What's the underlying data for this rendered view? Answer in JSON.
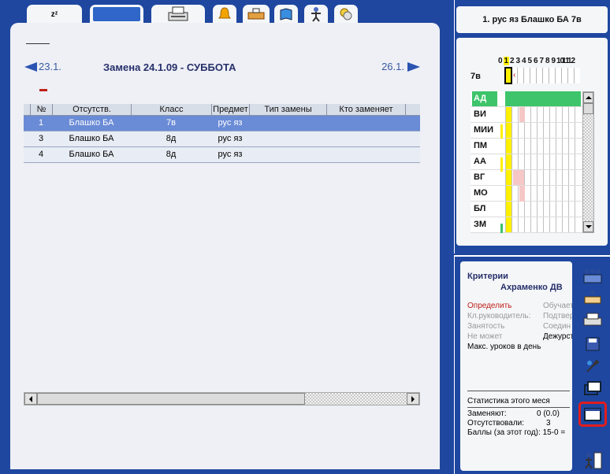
{
  "left": {
    "tabs": [
      {
        "name": "tab-sleep",
        "glyph": "z",
        "color": "#f4f6f8"
      },
      {
        "name": "tab-people",
        "glyph": "",
        "color": "#2f66c8"
      },
      {
        "name": "tab-print",
        "glyph": "",
        "color": "#f4f6f8"
      },
      {
        "name": "tab-bell",
        "glyph": "",
        "color": "#f4f6f8"
      },
      {
        "name": "tab-desk",
        "glyph": "",
        "color": "#f4f6f8"
      },
      {
        "name": "tab-book",
        "glyph": "",
        "color": "#f4f6f8"
      },
      {
        "name": "tab-person",
        "glyph": "",
        "color": "#f4f6f8"
      },
      {
        "name": "tab-coins",
        "glyph": "",
        "color": "#f4f6f8"
      }
    ],
    "nav": {
      "prev_label": "23.1.",
      "title": "Замена 24.1.09 - СУББОТА",
      "next_label": "26.1."
    },
    "table": {
      "headers": [
        "№",
        "Отсутств.",
        "Класс",
        "Предмет",
        "Тип замены",
        "Кто заменяет"
      ],
      "rows": [
        {
          "num": "1",
          "absent": "Блашко БА",
          "class": "7в",
          "subject": "рус яз",
          "type": "",
          "who": ""
        },
        {
          "num": "3",
          "absent": "Блашко БА",
          "class": "8д",
          "subject": "рус яз",
          "type": "",
          "who": ""
        },
        {
          "num": "4",
          "absent": "Блашко БА",
          "class": "8д",
          "subject": "рус яз",
          "type": "",
          "who": ""
        }
      ]
    }
  },
  "right_top": {
    "info": "1. рус яз Блашко БА 7в",
    "periods": [
      "0",
      "1",
      "2",
      "3",
      "4",
      "5",
      "6",
      "7",
      "8",
      "9",
      "10",
      "11",
      "12"
    ],
    "class_label": "7в",
    "teachers": [
      "АД",
      "ВИ",
      "МИИ",
      "ПМ",
      "АА",
      "ВГ",
      "МО",
      "БЛ",
      "ЗМ"
    ]
  },
  "right_bottom": {
    "criteria_title": "Критерии",
    "teacher_name": "Ахраменко ДВ",
    "criteria": [
      {
        "left": "Определить",
        "right": "Обучает"
      },
      {
        "left": "Кл.руководитель:",
        "right": "Подтвер"
      },
      {
        "left": "Занятость",
        "right": "Соедин"
      },
      {
        "left": "Не может",
        "right": "Дежурст"
      }
    ],
    "max_lessons": "Макс. уроков в день",
    "stats_title": "Статистика этого меся",
    "stats": [
      {
        "label": "Заменяют:",
        "value": "0 (0.0)"
      },
      {
        "label": "Отсутствовали:",
        "value": "3"
      },
      {
        "label": "Баллы (за этот год):",
        "value": "15-0 ="
      }
    ]
  }
}
